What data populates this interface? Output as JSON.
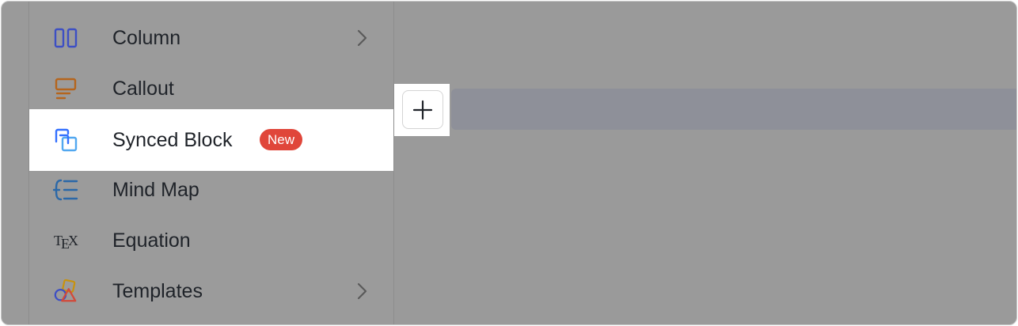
{
  "menu": {
    "items": [
      {
        "label": "Column",
        "icon": "column-icon",
        "has_submenu": true
      },
      {
        "label": "Callout",
        "icon": "callout-icon",
        "has_submenu": false
      },
      {
        "label": "Synced Block",
        "icon": "synced-block-icon",
        "badge": "New",
        "highlighted": true
      },
      {
        "label": "Mind Map",
        "icon": "mind-map-icon",
        "has_submenu": false
      },
      {
        "label": "Equation",
        "icon": "equation-icon",
        "icon_text": "TEX"
      },
      {
        "label": "Templates",
        "icon": "templates-icon",
        "has_submenu": true
      }
    ]
  },
  "colors": {
    "badge": "#e0463a",
    "column_icon": "#4a5bd4",
    "callout_icon": "#c46a17",
    "synced_icon": "#3370ff",
    "mind_map_icon": "#2f6fb0"
  },
  "add_button": {
    "icon": "plus-icon"
  }
}
